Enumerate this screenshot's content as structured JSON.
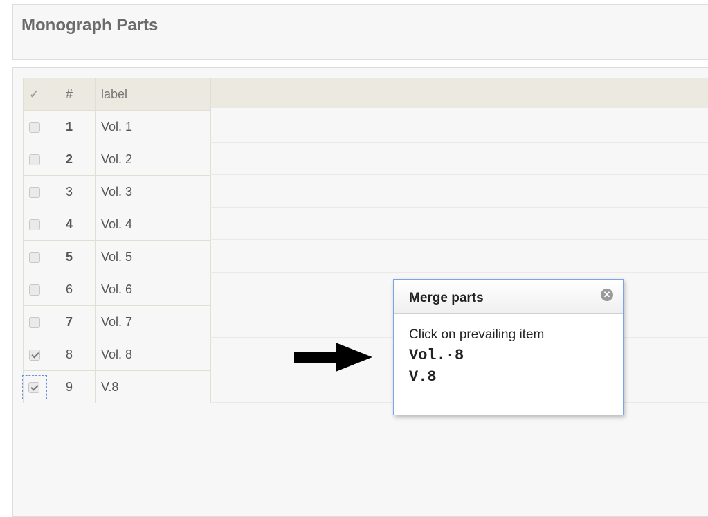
{
  "page": {
    "title": "Monograph Parts"
  },
  "grid": {
    "columns": {
      "check": "✓",
      "num": "#",
      "label": "label"
    },
    "rows": [
      {
        "num": "1",
        "label": "Vol. 1",
        "checked": false,
        "bold": true
      },
      {
        "num": "2",
        "label": "Vol. 2",
        "checked": false,
        "bold": true
      },
      {
        "num": "3",
        "label": "Vol. 3",
        "checked": false,
        "bold": false
      },
      {
        "num": "4",
        "label": "Vol. 4",
        "checked": false,
        "bold": true
      },
      {
        "num": "5",
        "label": "Vol. 5",
        "checked": false,
        "bold": true
      },
      {
        "num": "6",
        "label": "Vol. 6",
        "checked": false,
        "bold": false
      },
      {
        "num": "7",
        "label": "Vol. 7",
        "checked": false,
        "bold": true
      },
      {
        "num": "8",
        "label": "Vol. 8",
        "checked": true,
        "bold": false
      },
      {
        "num": "9",
        "label": "V.8",
        "checked": true,
        "bold": false
      }
    ]
  },
  "dialog": {
    "title": "Merge parts",
    "instruction": "Click on prevailing item",
    "options": [
      "Vol.·8",
      "V.8"
    ]
  },
  "icons": {
    "close": "close-circle-icon",
    "arrow": "right-arrow-icon"
  },
  "colors": {
    "dialog_border": "#7aa3e8",
    "header_bg": "#ece9e1"
  }
}
